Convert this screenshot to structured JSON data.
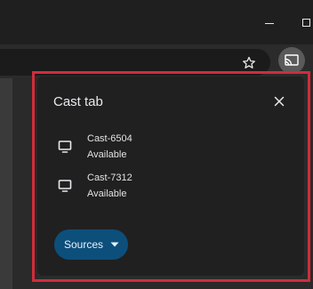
{
  "popup": {
    "title": "Cast tab",
    "devices": [
      {
        "name": "Cast-6504",
        "status": "Available",
        "icon": "monitor-icon"
      },
      {
        "name": "Cast-7312",
        "status": "Available",
        "icon": "monitor-icon"
      }
    ],
    "sources_label": "Sources"
  },
  "colors": {
    "popup_bg": "#202020",
    "highlight": "#d02d3b",
    "sources_button": "#0d4f7b",
    "cast_button": "#5a5a5a"
  },
  "icons": {
    "toolbar": [
      "star-icon",
      "cast-icon"
    ],
    "window": [
      "minimize-icon",
      "maximize-icon"
    ],
    "popup": [
      "close-icon",
      "caret-down-icon"
    ]
  }
}
